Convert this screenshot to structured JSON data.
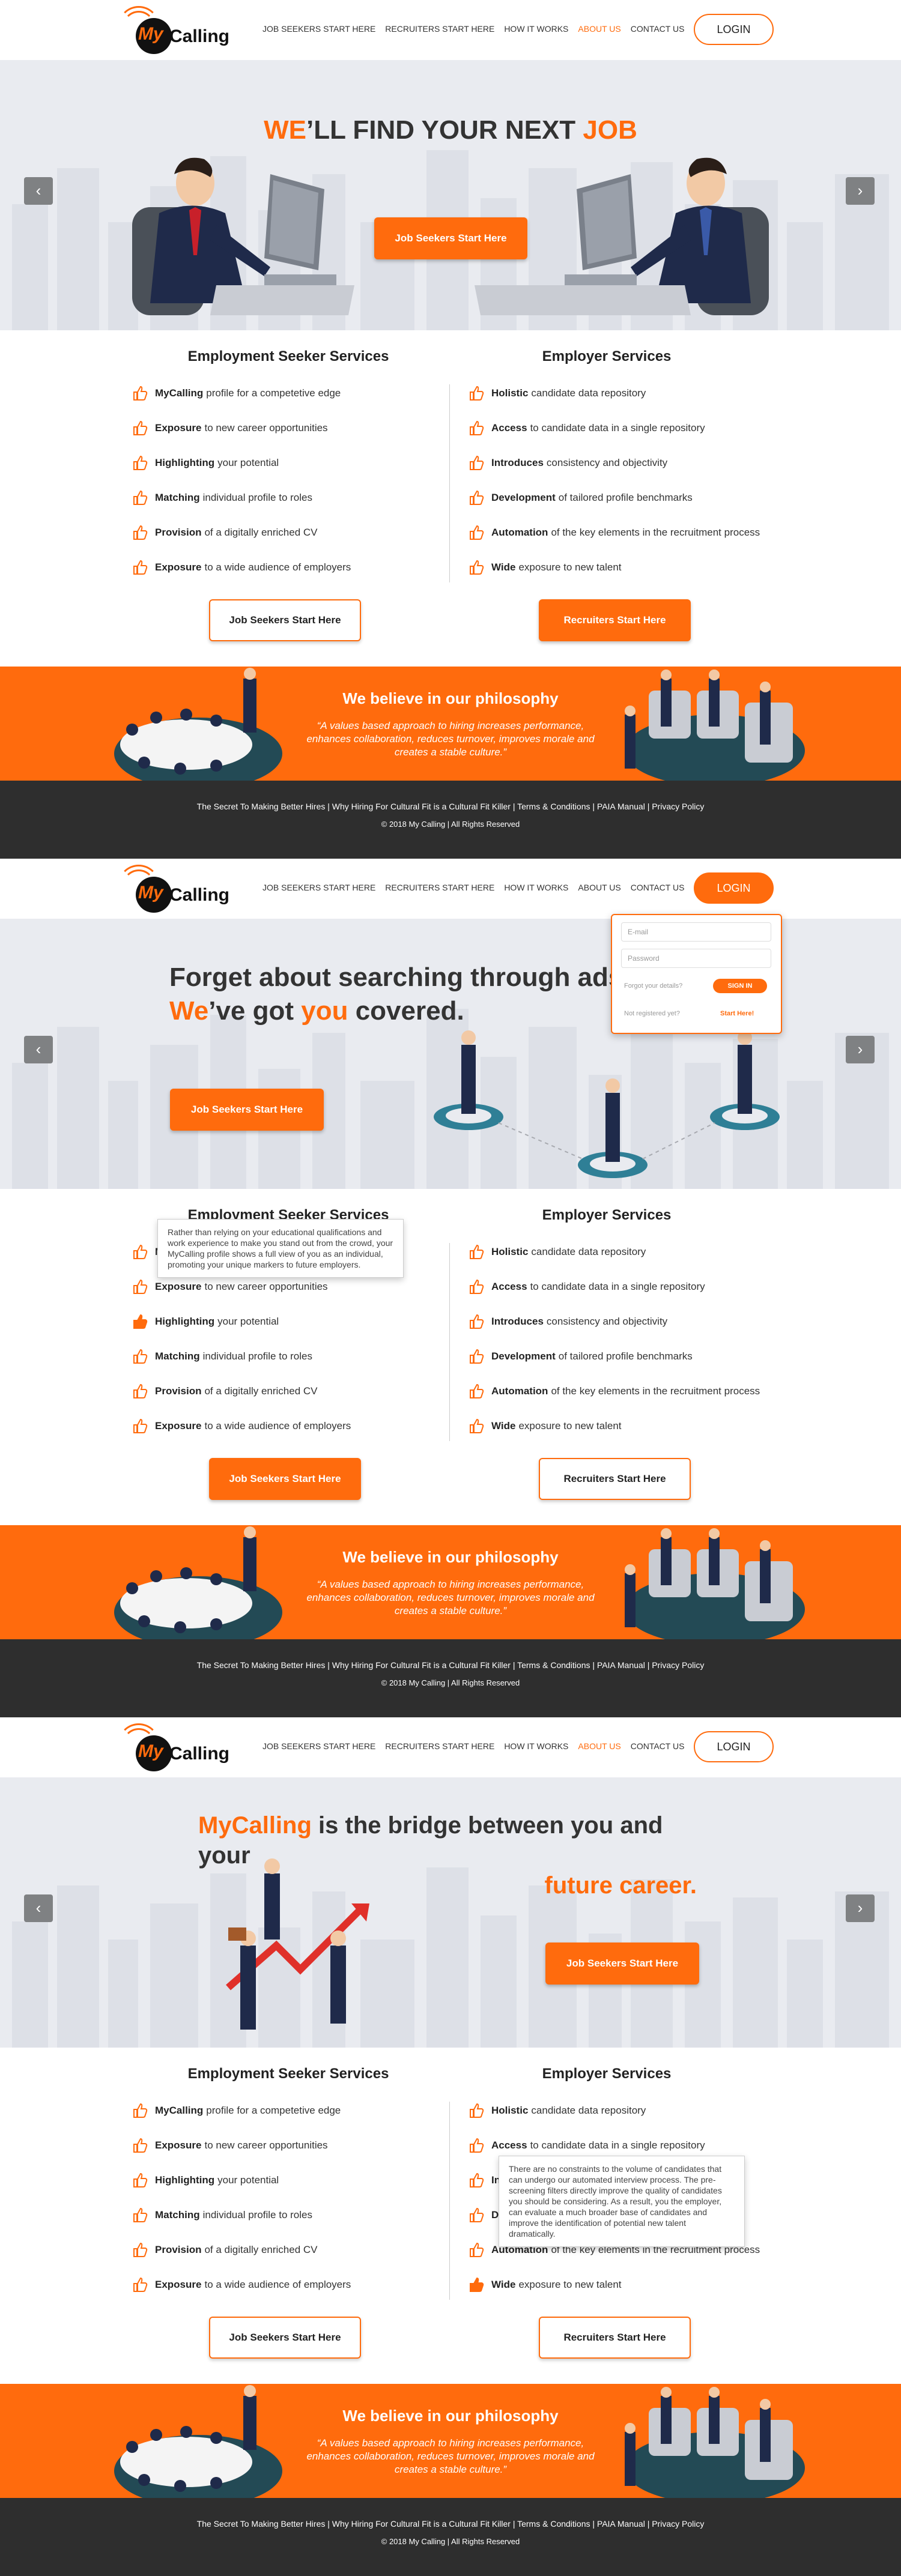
{
  "brand": {
    "logo_my": "My",
    "logo_calling": "Calling",
    "accent": "#ff6b0d",
    "dark": "#2e2e2e"
  },
  "nav": {
    "items": [
      "JOB SEEKERS START HERE",
      "RECRUITERS START HERE",
      "HOW IT WORKS",
      "ABOUT US",
      "CONTACT US"
    ],
    "login": "LOGIN"
  },
  "hero1": {
    "we": "WE",
    "mid": "’LL FIND YOUR NEXT ",
    "job": "JOB",
    "button": "Job Seekers Start Here"
  },
  "hero2": {
    "line1": "Forget about searching through ads hour",
    "we": "We",
    "mid": "’ve got ",
    "you": "you",
    "end": " covered.",
    "button": "Job Seekers Start Here"
  },
  "hero3": {
    "brand": "MyCalling",
    "line1": " is the bridge between you and your",
    "line2": "future career.",
    "button": "Job Seekers Start Here"
  },
  "login_popup": {
    "email": "E-mail",
    "password": "Password",
    "forgot": "Forgot your details?",
    "signin": "SIGN IN",
    "not_registered": "Not registered yet?",
    "start": "Start Here!"
  },
  "seeker": {
    "title": "Employment Seeker Services",
    "items": [
      {
        "bold": "MyCalling",
        "text": "profile for a competetive edge"
      },
      {
        "bold": "Exposure",
        "text": "to new career opportunities"
      },
      {
        "bold": "Highlighting",
        "text": "your potential"
      },
      {
        "bold": "Matching",
        "text": "individual profile to roles"
      },
      {
        "bold": "Provision",
        "text": "of a digitally enriched CV"
      },
      {
        "bold": "Exposure",
        "text": "to a wide audience of employers"
      }
    ],
    "button": "Job Seekers Start Here"
  },
  "employer": {
    "title": "Employer Services",
    "items": [
      {
        "bold": "Holistic",
        "text": "candidate data repository"
      },
      {
        "bold": "Access",
        "text": "to candidate data in a single repository"
      },
      {
        "bold": "Introduces",
        "text": "consistency and objectivity"
      },
      {
        "bold": "Development",
        "text": "of tailored profile benchmarks"
      },
      {
        "bold": "Automation",
        "text": "of the key elements in the recruitment process"
      },
      {
        "bold": "Wide",
        "text": "exposure to new talent"
      }
    ],
    "button": "Recruiters Start Here"
  },
  "tooltip_seeker": "Rather than relying on your educational qualifications and work experience to make you stand out from the crowd, your MyCalling profile shows a full view of you as an individual, promoting your unique markers to future employers.",
  "tooltip_employer": "There are no constraints to the volume of candidates that can undergo our automated interview process. The pre-screening filters directly improve the quality of candidates you should be considering. As a result, you the employer, can evaluate a much broader base of candidates and improve the identification of potential new talent dramatically.",
  "philosophy": {
    "title": "We believe in our philosophy",
    "quote": "“A values based approach to hiring increases performance, enhances collaboration, reduces turnover, improves morale and creates a stable culture.”"
  },
  "footer": {
    "links": "The Secret To Making Better Hires | Why Hiring For Cultural Fit is a Cultural Fit Killer | Terms & Conditions | PAIA Manual | Privacy Policy",
    "copyright": "© 2018 My Calling | All Rights Reserved"
  }
}
